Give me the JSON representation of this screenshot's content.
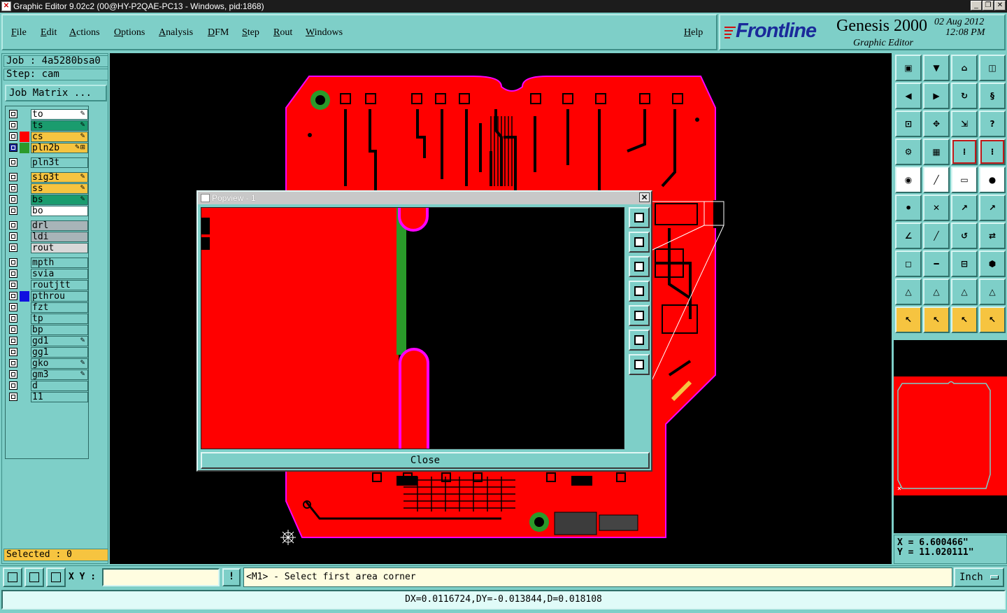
{
  "window": {
    "title": "Graphic Editor 9.02c2 (00@HY-P2QAE-PC13 - Windows, pid:1868)"
  },
  "menu": {
    "items": [
      "File",
      "Edit",
      "Actions",
      "Options",
      "Analysis",
      "DFM",
      "Step",
      "Rout",
      "Windows"
    ],
    "help": "Help"
  },
  "brand": {
    "logo": "Frontline",
    "product": "Genesis 2000",
    "subtitle": "Graphic Editor",
    "date": "02 Aug 2012",
    "time": "12:08 PM"
  },
  "job": {
    "job_line": "Job : 4a5280bsa0",
    "step_line": "Step: cam",
    "matrix_label": "Job Matrix ..."
  },
  "layers": [
    {
      "name": "to",
      "color": "#ffffff",
      "swatch": "",
      "mark": "✎"
    },
    {
      "name": "ts",
      "color": "#1a9c6e",
      "swatch": "",
      "mark": "✎"
    },
    {
      "name": "cs",
      "color": "#f6c440",
      "swatch": "#ff0000",
      "mark": "✎"
    },
    {
      "name": "pln2b",
      "color": "#f6c440",
      "swatch": "#2a9a2a",
      "mark": "✎⊞",
      "active": true
    },
    {
      "name": "pln3t",
      "color": "#7ecfc8",
      "swatch": "",
      "mark": ""
    },
    {
      "name": "sig3t",
      "color": "#f6c440",
      "swatch": "",
      "mark": "✎"
    },
    {
      "name": "ss",
      "color": "#f6c440",
      "swatch": "",
      "mark": "✎"
    },
    {
      "name": "bs",
      "color": "#1a9c6e",
      "swatch": "",
      "mark": "✎"
    },
    {
      "name": "bo",
      "color": "#ffffff",
      "swatch": "",
      "mark": ""
    },
    {
      "name": "drl",
      "color": "#a8b4b8",
      "swatch": "",
      "mark": ""
    },
    {
      "name": "ldi",
      "color": "#a8b4b8",
      "swatch": "",
      "mark": ""
    },
    {
      "name": "rout",
      "color": "#d8d8d8",
      "swatch": "",
      "mark": ""
    },
    {
      "name": "mpth",
      "color": "#7ecfc8",
      "swatch": "",
      "mark": ""
    },
    {
      "name": "svia",
      "color": "#7ecfc8",
      "swatch": "",
      "mark": ""
    },
    {
      "name": "routjtt",
      "color": "#7ecfc8",
      "swatch": "",
      "mark": ""
    },
    {
      "name": "pthrou",
      "color": "#7ecfc8",
      "swatch": "#1010e0",
      "mark": ""
    },
    {
      "name": "fzt",
      "color": "#7ecfc8",
      "swatch": "",
      "mark": ""
    },
    {
      "name": "tp",
      "color": "#7ecfc8",
      "swatch": "",
      "mark": ""
    },
    {
      "name": "bp",
      "color": "#7ecfc8",
      "swatch": "",
      "mark": ""
    },
    {
      "name": "gd1",
      "color": "#7ecfc8",
      "swatch": "",
      "mark": "✎"
    },
    {
      "name": "gg1",
      "color": "#7ecfc8",
      "swatch": "",
      "mark": ""
    },
    {
      "name": "gko",
      "color": "#7ecfc8",
      "swatch": "",
      "mark": "✎"
    },
    {
      "name": "gm3",
      "color": "#7ecfc8",
      "swatch": "",
      "mark": "✎"
    },
    {
      "name": "d",
      "color": "#7ecfc8",
      "swatch": "",
      "mark": ""
    },
    {
      "name": "11",
      "color": "#7ecfc8",
      "swatch": "",
      "mark": ""
    }
  ],
  "selected": "Selected : 0",
  "popview": {
    "title": "Popview - 1",
    "close_label": "Close",
    "close_x": "✕"
  },
  "coords": {
    "x": "X = 6.600466\"",
    "y": "Y = 11.020111\""
  },
  "command": {
    "xy_label": "X Y :",
    "xy_value": "",
    "warn": "!",
    "prompt": "<M1> - Select first area corner",
    "unit": "Inch"
  },
  "status": "DX=0.0116724,DY=-0.013844,D=0.018108",
  "colors": {
    "board": "#ff0000",
    "outline": "#ff00ff",
    "panel": "#7ecfc8",
    "highlight": "#f6c440"
  }
}
